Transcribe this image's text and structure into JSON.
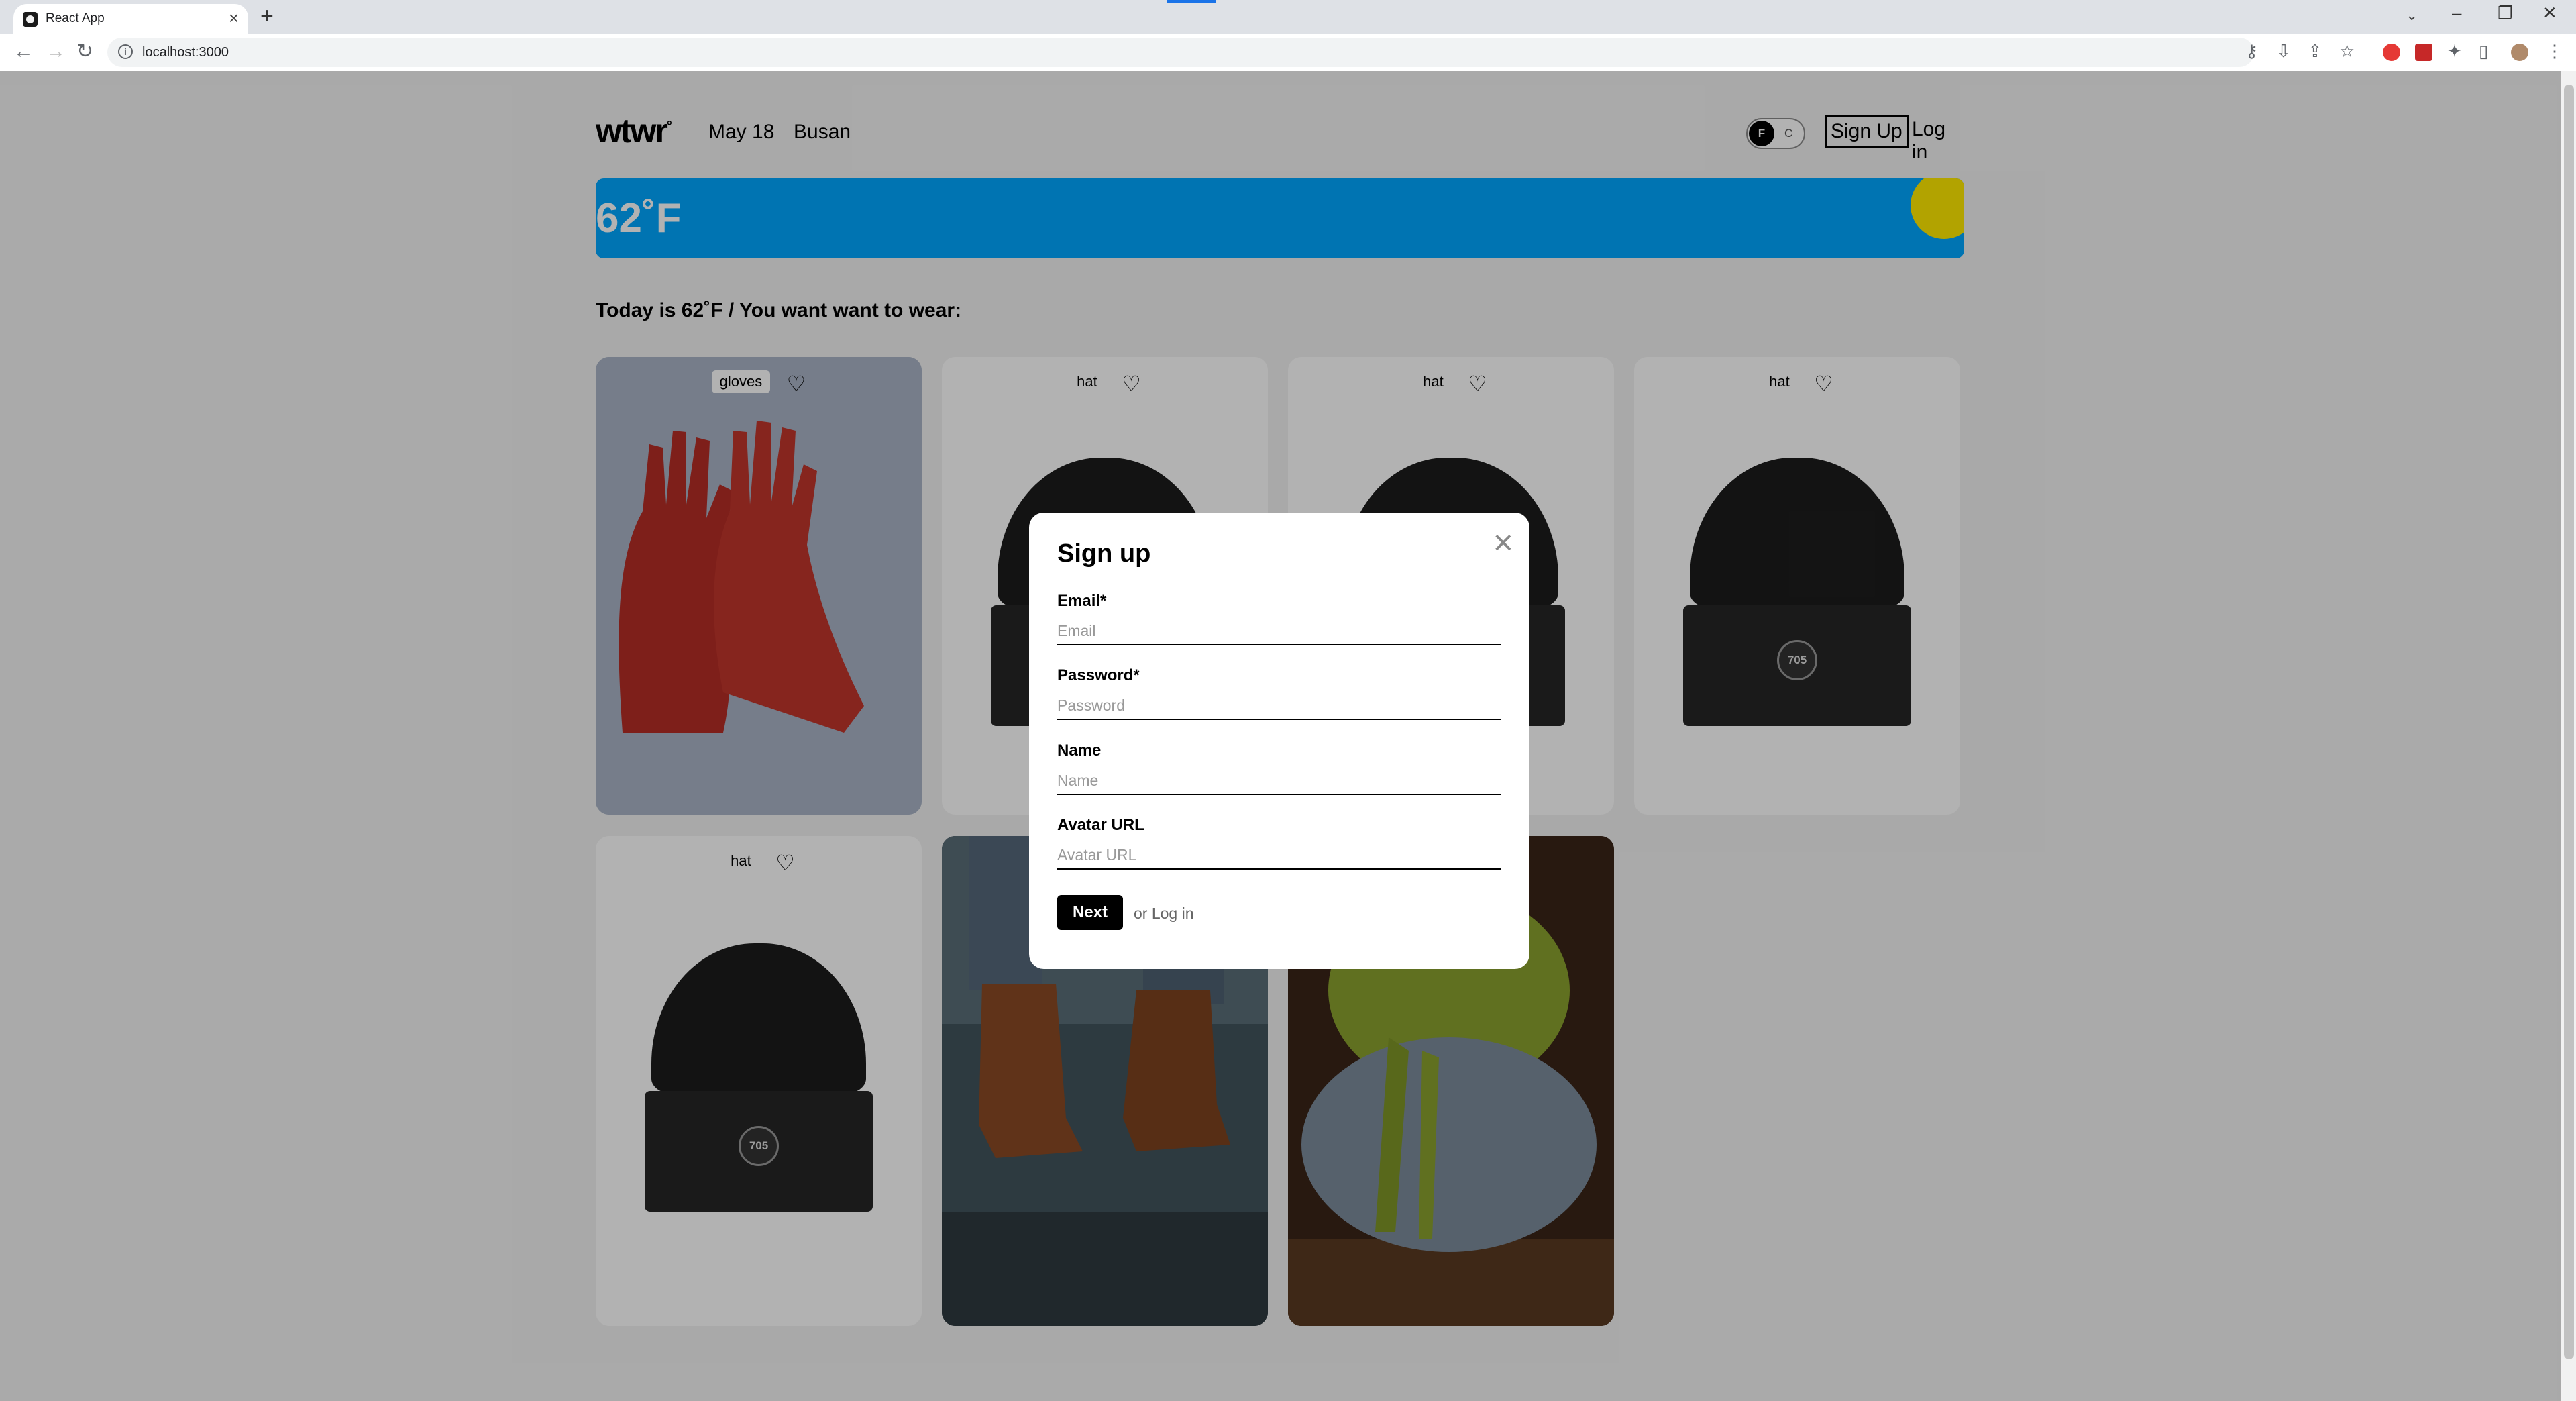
{
  "browser": {
    "tab_title": "React App",
    "tab_close": "×",
    "new_tab": "+",
    "url": "localhost:3000"
  },
  "header": {
    "logo": "wtwr",
    "logo_mark": "°",
    "date": "May 18",
    "city": "Busan",
    "toggle_f": "F",
    "toggle_c": "C",
    "signup": "Sign Up",
    "login": "Log in"
  },
  "weather": {
    "temperature": "62˚F"
  },
  "main": {
    "today_text": "Today is 62˚F / You want want to wear:"
  },
  "cards": [
    {
      "name": "gloves"
    },
    {
      "name": "hat"
    },
    {
      "name": "hat"
    },
    {
      "name": "hat"
    },
    {
      "name": "hat"
    }
  ],
  "beanie_patch": "705",
  "modal": {
    "title": "Sign up",
    "close": "×",
    "fields": [
      {
        "label": "Email*",
        "placeholder": "Email"
      },
      {
        "label": "Password*",
        "placeholder": "Password"
      },
      {
        "label": "Name",
        "placeholder": "Name"
      },
      {
        "label": "Avatar URL",
        "placeholder": "Avatar URL"
      }
    ],
    "submit": "Next",
    "alt_link": "or Log in"
  },
  "colors": {
    "weather_bg": "#00a6ff",
    "sun": "#ffea00",
    "modal_bg": "#ffffff",
    "overlay": "rgba(0,0,0,0.3)"
  }
}
